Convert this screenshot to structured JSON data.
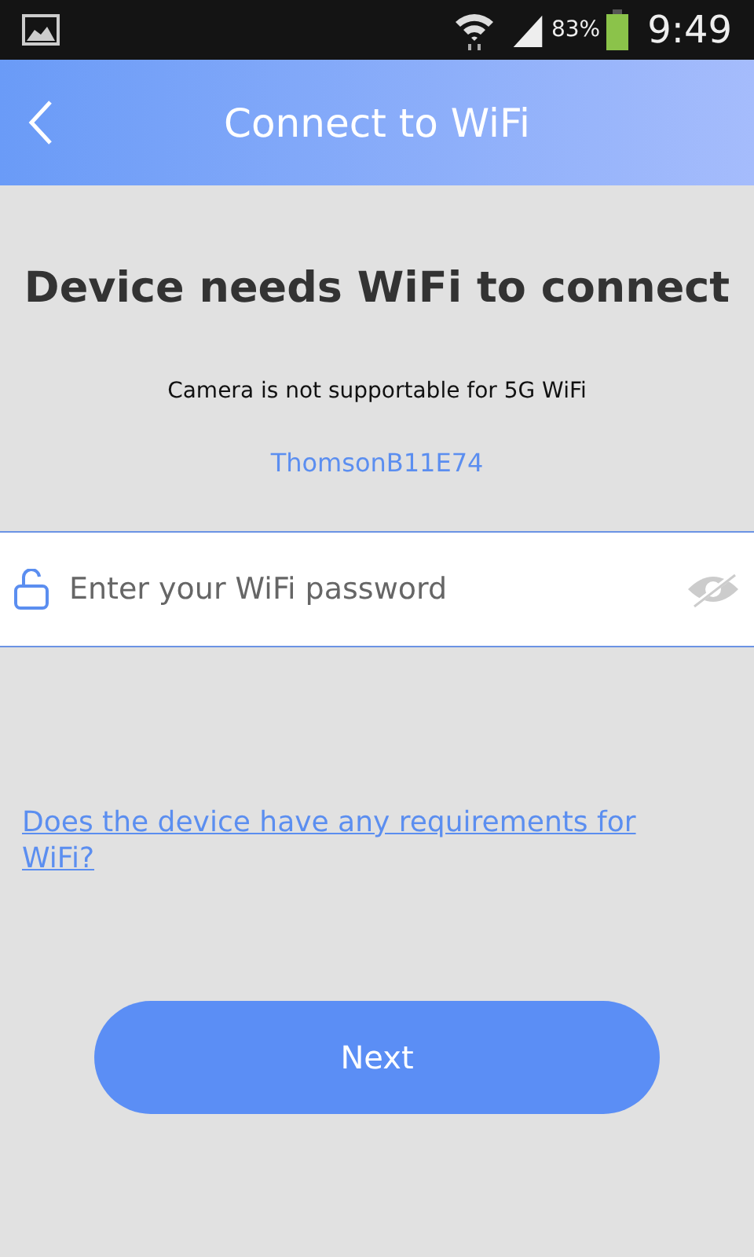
{
  "status_bar": {
    "battery": "83%",
    "time": "9:49"
  },
  "header": {
    "title": "Connect to WiFi"
  },
  "heading": "Device needs WiFi to connect",
  "note": "Camera is not supportable for 5G WiFi",
  "network_name": "ThomsonB11E74",
  "password_field": {
    "placeholder": "Enter your WiFi password"
  },
  "help_link": "Does the device have any requirements for WiFi?",
  "buttons": [
    "Next"
  ]
}
